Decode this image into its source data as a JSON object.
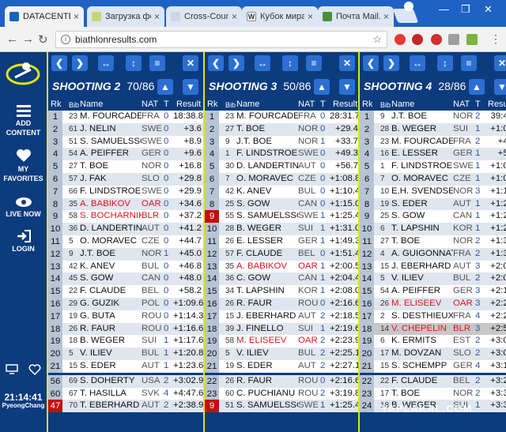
{
  "browser": {
    "tabs": [
      {
        "title": "DATACENTER",
        "color": "#1565c0"
      },
      {
        "title": "Загрузка фо",
        "color": "#c8d67a"
      },
      {
        "title": "Cross-Counti",
        "color": "#ccd6e6"
      },
      {
        "title": "Кубок мира",
        "color": "#ffffff"
      },
      {
        "title": "Почта Mail.R",
        "color": "#4a8f3c"
      }
    ],
    "url": "biathlonresults.com",
    "ext_colors": [
      "#e53935",
      "#c62828",
      "#d32f2f",
      "#9e9e9e",
      "#7cb342"
    ]
  },
  "sidebar": {
    "add_content": "ADD CONTENT",
    "my_favorites": "MY FAVORITES",
    "live_now": "LIVE NOW",
    "login": "LOGIN",
    "time": "21:14:41",
    "location": "PyeongChang"
  },
  "columns": {
    "rk": "Rk",
    "bib": "Bib",
    "name": "Name",
    "nat": "NAT",
    "t": "T",
    "result": "Result"
  },
  "panels": [
    {
      "title": "SHOOTING 2",
      "count": "70/86",
      "rows": [
        {
          "rk": "1",
          "bib": "23",
          "name": "M. FOURCADE",
          "nat": "FRA",
          "t": "0",
          "res": "18:38.8"
        },
        {
          "rk": "2",
          "bib": "61",
          "name": "J. NELIN",
          "nat": "SWE",
          "t": "0",
          "res": "+3.6"
        },
        {
          "rk": "3",
          "bib": "51",
          "name": "S. SAMUELSSON",
          "nat": "SWE",
          "t": "0",
          "res": "+8.9"
        },
        {
          "rk": "4",
          "bib": "54",
          "name": "A. PEIFFER",
          "nat": "GER",
          "t": "0",
          "res": "+9.6"
        },
        {
          "rk": "5",
          "bib": "27",
          "name": "T. BOE",
          "nat": "NOR",
          "t": "0",
          "res": "+16.8"
        },
        {
          "rk": "6",
          "bib": "57",
          "name": "J. FAK",
          "nat": "SLO",
          "t": "0",
          "res": "+29.8"
        },
        {
          "rk": "7",
          "bib": "66",
          "name": "F. LINDSTROEM",
          "nat": "SWE",
          "t": "0",
          "res": "+29.9"
        },
        {
          "rk": "8",
          "bib": "35",
          "name": "A. BABIKOV",
          "nat": "OAR",
          "t": "0",
          "res": "+34.6",
          "red": true
        },
        {
          "rk": "9",
          "bib": "58",
          "name": "S. BOCHARNIKO",
          "nat": "BLR",
          "t": "0",
          "res": "+37.2",
          "red": true
        },
        {
          "rk": "10",
          "bib": "36",
          "name": "D. LANDERTINGE",
          "nat": "AUT",
          "t": "0",
          "res": "+41.2"
        },
        {
          "rk": "11",
          "bib": "5",
          "name": "O. MORAVEC",
          "nat": "CZE",
          "t": "0",
          "res": "+44.7"
        },
        {
          "rk": "12",
          "bib": "9",
          "name": "J.T. BOE",
          "nat": "NOR",
          "t": "1",
          "res": "+45.0"
        },
        {
          "rk": "13",
          "bib": "42",
          "name": "K. ANEV",
          "nat": "BUL",
          "t": "0",
          "res": "+46.8"
        },
        {
          "rk": "14",
          "bib": "45",
          "name": "S. GOW",
          "nat": "CAN",
          "t": "0",
          "res": "+48.0"
        },
        {
          "rk": "15",
          "bib": "22",
          "name": "F. CLAUDE",
          "nat": "BEL",
          "t": "0",
          "res": "+58.2"
        },
        {
          "rk": "16",
          "bib": "29",
          "name": "G. GUZIK",
          "nat": "POL",
          "t": "0",
          "res": "+1:09.6"
        },
        {
          "rk": "17",
          "bib": "19",
          "name": "G. BUTA",
          "nat": "ROU",
          "t": "0",
          "res": "+1:14.3"
        },
        {
          "rk": "18",
          "bib": "26",
          "name": "R. FAUR",
          "nat": "ROU",
          "t": "0",
          "res": "+1:16.6"
        },
        {
          "rk": "19",
          "bib": "18",
          "name": "B. WEGER",
          "nat": "SUI",
          "t": "1",
          "res": "+1:17.6"
        },
        {
          "rk": "20",
          "bib": "5",
          "name": "V. ILIEV",
          "nat": "BUL",
          "t": "1",
          "res": "+1:20.8"
        },
        {
          "rk": "21",
          "bib": "15",
          "name": "S. EDER",
          "nat": "AUT",
          "t": "1",
          "res": "+1:23.6"
        },
        {
          "rk": "56",
          "bib": "69",
          "name": "S. DOHERTY",
          "nat": "USA",
          "t": "2",
          "res": "+3:02.9"
        },
        {
          "rk": "60",
          "bib": "67",
          "name": "T. HASILLA",
          "nat": "SVK",
          "t": "4",
          "res": "+4:47.6"
        },
        {
          "rk": "47",
          "bib": "70",
          "name": "T. EBERHARD",
          "nat": "AUT",
          "t": "2",
          "res": "+2:38.9",
          "rkred": true
        }
      ]
    },
    {
      "title": "SHOOTING 3",
      "count": "50/86",
      "rows": [
        {
          "rk": "1",
          "bib": "23",
          "name": "M. FOURCADE",
          "nat": "FRA",
          "t": "0",
          "res": "28:31.7"
        },
        {
          "rk": "2",
          "bib": "27",
          "name": "T. BOE",
          "nat": "NOR",
          "t": "0",
          "res": "+29.4"
        },
        {
          "rk": "3",
          "bib": "9",
          "name": "J.T. BOE",
          "nat": "NOR",
          "t": "1",
          "res": "+33.7"
        },
        {
          "rk": "4",
          "bib": "1",
          "name": "F. LINDSTROEM",
          "nat": "SWE",
          "t": "0",
          "res": "+49.3"
        },
        {
          "rk": "5",
          "bib": "30",
          "name": "D. LANDERTINGE",
          "nat": "AUT",
          "t": "0",
          "res": "+56.7"
        },
        {
          "rk": "6",
          "bib": "7",
          "name": "O. MORAVEC",
          "nat": "CZE",
          "t": "0",
          "res": "+1:08.8"
        },
        {
          "rk": "7",
          "bib": "42",
          "name": "K. ANEV",
          "nat": "BUL",
          "t": "0",
          "res": "+1:10.4"
        },
        {
          "rk": "8",
          "bib": "25",
          "name": "S. GOW",
          "nat": "CAN",
          "t": "0",
          "res": "+1:15.0"
        },
        {
          "rk": "9",
          "bib": "55",
          "name": "S. SAMUELSSON",
          "nat": "SWE",
          "t": "1",
          "res": "+1:25.4",
          "rkred": true
        },
        {
          "rk": "10",
          "bib": "28",
          "name": "B. WEGER",
          "nat": "SUI",
          "t": "1",
          "res": "+1:31.0"
        },
        {
          "rk": "11",
          "bib": "26",
          "name": "E. LESSER",
          "nat": "GER",
          "t": "1",
          "res": "+1:49.3"
        },
        {
          "rk": "12",
          "bib": "57",
          "name": "F. CLAUDE",
          "nat": "BEL",
          "t": "0",
          "res": "+1:51.4"
        },
        {
          "rk": "13",
          "bib": "35",
          "name": "A. BABIKOV",
          "nat": "OAR",
          "t": "1",
          "res": "+2:00.5",
          "red": true
        },
        {
          "rk": "14",
          "bib": "36",
          "name": "C. GOW",
          "nat": "CAN",
          "t": "1",
          "res": "+2:04.4"
        },
        {
          "rk": "15",
          "bib": "34",
          "name": "T. LAPSHIN",
          "nat": "KOR",
          "t": "1",
          "res": "+2:08.0"
        },
        {
          "rk": "16",
          "bib": "26",
          "name": "R. FAUR",
          "nat": "ROU",
          "t": "0",
          "res": "+2:16.6"
        },
        {
          "rk": "17",
          "bib": "15",
          "name": "J. EBERHARD",
          "nat": "AUT",
          "t": "2",
          "res": "+2:18.5"
        },
        {
          "rk": "18",
          "bib": "39",
          "name": "J. FINELLO",
          "nat": "SUI",
          "t": "1",
          "res": "+2:19.6"
        },
        {
          "rk": "19",
          "bib": "58",
          "name": "M. ELISEEV",
          "nat": "OAR",
          "t": "2",
          "res": "+2:23.9",
          "red": true
        },
        {
          "rk": "20",
          "bib": "5",
          "name": "V. ILIEV",
          "nat": "BUL",
          "t": "2",
          "res": "+2:25.1"
        },
        {
          "rk": "21",
          "bib": "19",
          "name": "S. EDER",
          "nat": "AUT",
          "t": "2",
          "res": "+2:27.1"
        },
        {
          "rk": "22",
          "bib": "26",
          "name": "R. FAUR",
          "nat": "ROU",
          "t": "0",
          "res": "+2:16.6"
        },
        {
          "rk": "23",
          "bib": "60",
          "name": "C. PUCHIANU",
          "nat": "ROU",
          "t": "2",
          "res": "+3:19.8"
        },
        {
          "rk": "9",
          "bib": "51",
          "name": "S. SAMUELSSON",
          "nat": "SWE",
          "t": "1",
          "res": "+1:25.4",
          "rkred": true
        }
      ]
    },
    {
      "title": "SHOOTING 4",
      "count": "28/86",
      "rows": [
        {
          "rk": "1",
          "bib": "9",
          "name": "J.T. BOE",
          "nat": "NOR",
          "t": "2",
          "res": "39:41"
        },
        {
          "rk": "2",
          "bib": "28",
          "name": "B. WEGER",
          "nat": "SUI",
          "t": "1",
          "res": "+1:00"
        },
        {
          "rk": "3",
          "bib": "23",
          "name": "M. FOURCADE",
          "nat": "FRA",
          "t": "2",
          "res": "+41"
        },
        {
          "rk": "4",
          "bib": "16",
          "name": "E. LESSER",
          "nat": "GER",
          "t": "1",
          "res": "+51"
        },
        {
          "rk": "5",
          "bib": "1",
          "name": "F. LINDSTROEM",
          "nat": "SWE",
          "t": "1",
          "res": "+1:00"
        },
        {
          "rk": "6",
          "bib": "7",
          "name": "O. MORAVEC",
          "nat": "CZE",
          "t": "1",
          "res": "+1:05"
        },
        {
          "rk": "7",
          "bib": "10",
          "name": "E.H. SVENDSEN",
          "nat": "NOR",
          "t": "3",
          "res": "+1:17"
        },
        {
          "rk": "8",
          "bib": "19",
          "name": "S. EDER",
          "nat": "AUT",
          "t": "1",
          "res": "+1:24"
        },
        {
          "rk": "9",
          "bib": "25",
          "name": "S. GOW",
          "nat": "CAN",
          "t": "1",
          "res": "+1:24"
        },
        {
          "rk": "10",
          "bib": "6",
          "name": "T. LAPSHIN",
          "nat": "KOR",
          "t": "1",
          "res": "+1:29"
        },
        {
          "rk": "11",
          "bib": "27",
          "name": "T. BOE",
          "nat": "NOR",
          "t": "2",
          "res": "+1:34"
        },
        {
          "rk": "12",
          "bib": "4",
          "name": "A. GUIGONNAT",
          "nat": "FRA",
          "t": "2",
          "res": "+1:35"
        },
        {
          "rk": "13",
          "bib": "15",
          "name": "J. EBERHARD",
          "nat": "AUT",
          "t": "3",
          "res": "+2:01"
        },
        {
          "rk": "14",
          "bib": "5",
          "name": "V. ILIEV",
          "nat": "BUL",
          "t": "2",
          "res": "+2:05"
        },
        {
          "rk": "15",
          "bib": "54",
          "name": "A. PEIFFER",
          "nat": "GER",
          "t": "3",
          "res": "+2:13"
        },
        {
          "rk": "16",
          "bib": "26",
          "name": "M. ELISEEV",
          "nat": "OAR",
          "t": "3",
          "res": "+2:21",
          "red": true
        },
        {
          "rk": "17",
          "bib": "2",
          "name": "S. DESTHIEUX",
          "nat": "FRA",
          "t": "4",
          "res": "+2:24"
        },
        {
          "rk": "18",
          "bib": "14",
          "name": "V. CHEPELIN",
          "nat": "BLR",
          "t": "3",
          "res": "+2:56",
          "red": true,
          "hl": true
        },
        {
          "rk": "19",
          "bib": "6",
          "name": "K. ERMITS",
          "nat": "EST",
          "t": "2",
          "res": "+3:04"
        },
        {
          "rk": "20",
          "bib": "17",
          "name": "M. DOVZAN",
          "nat": "SLO",
          "t": "2",
          "res": "+3:09"
        },
        {
          "rk": "21",
          "bib": "15",
          "name": "S. SCHEMPP",
          "nat": "GER",
          "t": "4",
          "res": "+3:10"
        },
        {
          "rk": "22",
          "bib": "22",
          "name": "F. CLAUDE",
          "nat": "BEL",
          "t": "2",
          "res": "+3:20"
        },
        {
          "rk": "23",
          "bib": "17",
          "name": "T. BOE",
          "nat": "NOR",
          "t": "2",
          "res": "+3:30"
        },
        {
          "rk": "24",
          "bib": "18",
          "name": "B. WEGER",
          "nat": "SUI",
          "t": "1",
          "res": "+3:31"
        }
      ]
    }
  ],
  "watermark": "YAPLAKAL.COM"
}
